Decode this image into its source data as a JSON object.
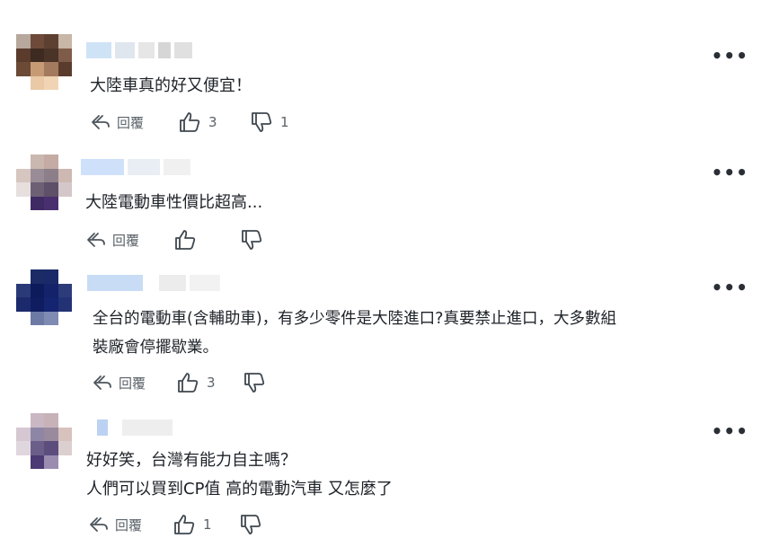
{
  "comments": [
    {
      "text": "大陸車真的好又便宜！",
      "reply_label": "回覆",
      "likes": "3",
      "dislikes": "1",
      "more_icon": "more-horizontal-icon"
    },
    {
      "text": "大陸電動車性價比超高...",
      "reply_label": "回覆",
      "likes": "",
      "dislikes": "",
      "more_icon": "more-horizontal-icon"
    },
    {
      "text": "全台的電動車(含輔助車)，有多少零件是大陸進口?真要禁止進口，大多數組\n裝廠會停擺歇業。",
      "reply_label": "回覆",
      "likes": "3",
      "dislikes": "",
      "more_icon": "more-horizontal-icon"
    },
    {
      "text": "好好笑，台灣有能力自主嗎？\n人們可以買到CP值 高的電動汽車 又怎麼了",
      "reply_label": "回覆",
      "likes": "1",
      "dislikes": "",
      "more_icon": "more-horizontal-icon"
    }
  ],
  "more_symbol": "•••"
}
